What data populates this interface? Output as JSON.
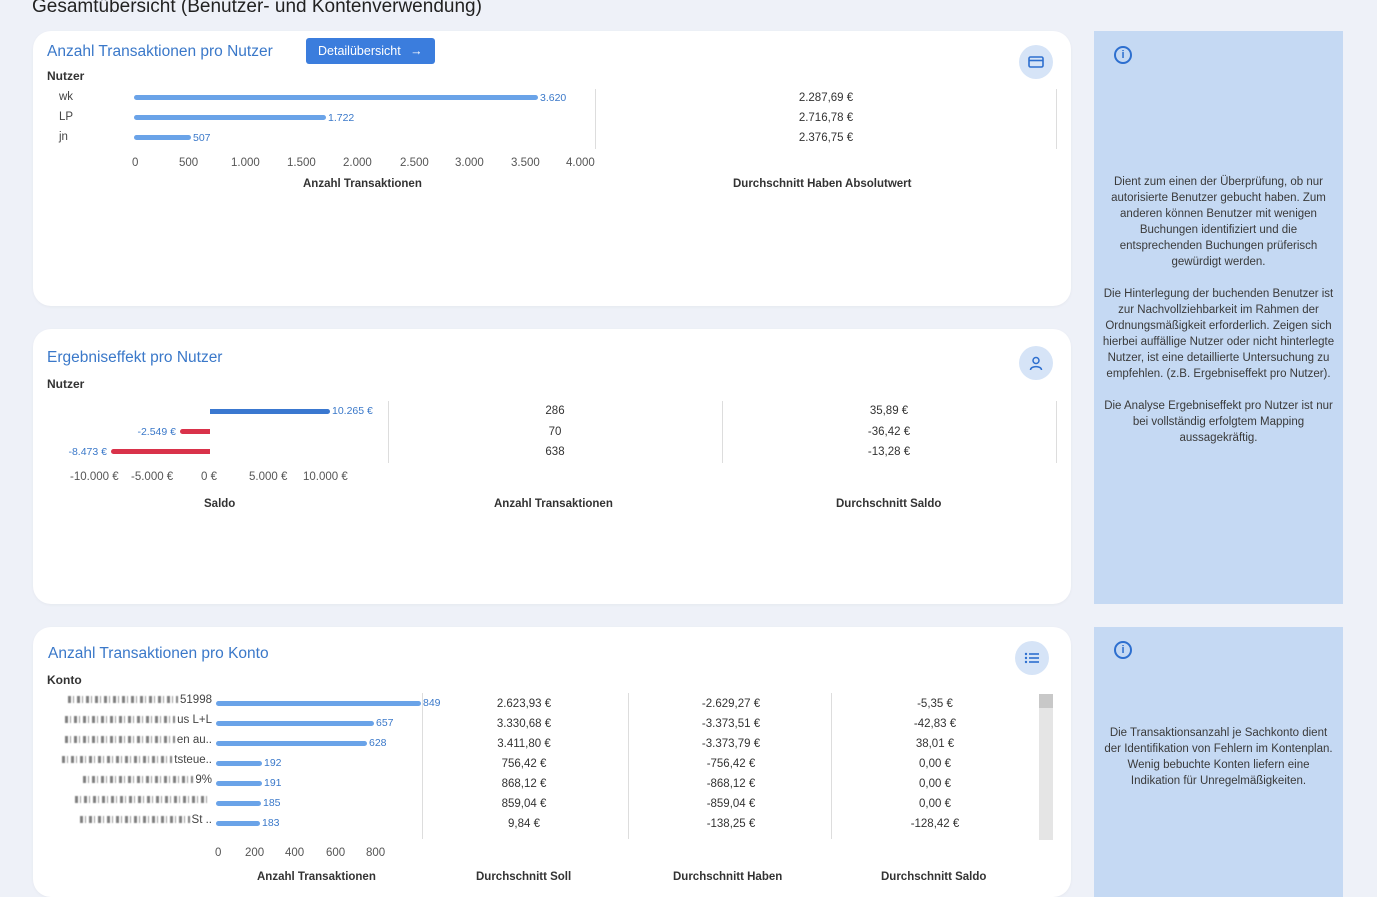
{
  "page_title": "Gesamtübersicht (Benutzer- und Kontenverwendung)",
  "card1": {
    "title": "Anzahl Transaktionen pro Nutzer",
    "button": "Detailübersicht",
    "dim_label": "Nutzer",
    "rows": [
      {
        "user": "wk",
        "count": 3620,
        "count_label": "3.620",
        "avg_haben": "2.287,69 €"
      },
      {
        "user": "LP",
        "count": 1722,
        "count_label": "1.722",
        "avg_haben": "2.716,78 €"
      },
      {
        "user": "jn",
        "count": 507,
        "count_label": "507",
        "avg_haben": "2.376,75 €"
      }
    ],
    "ticks": [
      "0",
      "500",
      "1.000",
      "1.500",
      "2.000",
      "2.500",
      "3.000",
      "3.500",
      "4.000"
    ],
    "axis_max": 4000,
    "xlabel": "Anzahl Transaktionen",
    "col2_title": "Durchschnitt Haben Absolutwert",
    "icon": "credit-card-icon"
  },
  "card2": {
    "title": "Ergebniseffekt pro Nutzer",
    "dim_label": "Nutzer",
    "rows": [
      {
        "saldo": 10265,
        "saldo_label": "10.265 €",
        "count": "286",
        "avg": "35,89 €"
      },
      {
        "saldo": -2549,
        "saldo_label": "-2.549 €",
        "count": "70",
        "avg": "-36,42 €"
      },
      {
        "saldo": -8473,
        "saldo_label": "-8.473 €",
        "count": "638",
        "avg": "-13,28 €"
      }
    ],
    "ticks": [
      "-10.000 €",
      "-5.000 €",
      "0 €",
      "5.000 €",
      "10.000 €"
    ],
    "xlabel": "Saldo",
    "col2_title": "Anzahl Transaktionen",
    "col3_title": "Durchschnitt Saldo",
    "icon": "user-icon"
  },
  "card3": {
    "title": "Anzahl Transaktionen pro Konto",
    "dim_label": "Konto",
    "rows": [
      {
        "konto": "51998",
        "count": 849,
        "soll": "2.623,93 €",
        "haben": "-2.629,27 €",
        "saldo": "-5,35 €"
      },
      {
        "konto": "us L+L",
        "count": 657,
        "soll": "3.330,68 €",
        "haben": "-3.373,51 €",
        "saldo": "-42,83 €"
      },
      {
        "konto": "en au..",
        "count": 628,
        "soll": "3.411,80 €",
        "haben": "-3.373,79 €",
        "saldo": "38,01 €"
      },
      {
        "konto": "tsteue..",
        "count": 192,
        "soll": "756,42 €",
        "haben": "-756,42 €",
        "saldo": "0,00 €"
      },
      {
        "konto": "9%",
        "count": 191,
        "soll": "868,12 €",
        "haben": "-868,12 €",
        "saldo": "0,00 €"
      },
      {
        "konto": "",
        "count": 185,
        "soll": "859,04 €",
        "haben": "-859,04 €",
        "saldo": "0,00 €"
      },
      {
        "konto": "St ..",
        "count": 183,
        "soll": "9,84 €",
        "haben": "-138,25 €",
        "saldo": "-128,42 €"
      }
    ],
    "ticks": [
      "0",
      "200",
      "400",
      "600",
      "800"
    ],
    "axis_max": 850,
    "xlabel": "Anzahl Transaktionen",
    "col2_title": "Durchschnitt Soll",
    "col3_title": "Durchschnitt Haben",
    "col4_title": "Durchschnitt Saldo",
    "icon": "list-icon"
  },
  "info1": {
    "text": "Dient zum einen der Überprüfung, ob nur autorisierte Benutzer gebucht haben. Zum anderen können Benutzer mit wenigen Buchungen identifiziert und die entsprechenden Buchungen prüferisch gewürdigt werden.\n\nDie Hinterlegung der buchenden Benutzer ist zur Nachvollziehbarkeit im Rahmen der Ordnungsmäßigkeit erforderlich. Zeigen sich hierbei auffällige Nutzer oder nicht hinterlegte Nutzer, ist eine detaillierte Untersuchung zu empfehlen. (z.B. Ergebniseffekt pro Nutzer).\n\nDie Analyse Ergebniseffekt pro Nutzer ist nur bei vollständig erfolgtem Mapping aussagekräftig."
  },
  "info2": {
    "text": "Die Transaktionsanzahl je Sachkonto dient der Identifikation von Fehlern im Kontenplan. Wenig bebuchte Konten liefern eine Indikation für Unregelmäßigkeiten."
  },
  "colors": {
    "bar": "#6aa3e8",
    "bar_dark": "#3a78d0",
    "bar_negative": "#d9324a",
    "title": "#3a78c9"
  }
}
